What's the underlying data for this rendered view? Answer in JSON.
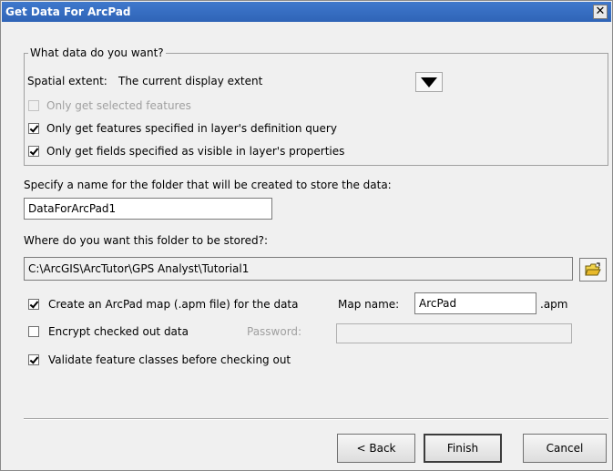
{
  "window": {
    "title": "Get Data For ArcPad",
    "close_label": "✕"
  },
  "data_group": {
    "legend": "What data do you want?",
    "spatial_extent_label": "Spatial extent:",
    "spatial_extent_value": "The current display extent",
    "options": [
      {
        "label": "Only get selected features",
        "checked": false,
        "enabled": false
      },
      {
        "label": "Only get features specified in layer's definition query",
        "checked": true,
        "enabled": true
      },
      {
        "label": "Only get fields specified as visible in layer's properties",
        "checked": true,
        "enabled": true
      }
    ]
  },
  "folder_name": {
    "label": "Specify a name for the folder that will be created to store the data:",
    "value": "DataForArcPad1"
  },
  "folder_location": {
    "label": "Where do you want this folder to be stored?:",
    "value": "C:\\ArcGIS\\ArcTutor\\GPS Analyst\\Tutorial1"
  },
  "map_options": {
    "create_map_label": "Create an ArcPad map (.apm file) for the data",
    "create_map_checked": true,
    "map_name_label": "Map name:",
    "map_name_value": "ArcPad",
    "map_ext": ".apm",
    "encrypt_label": "Encrypt checked out data",
    "encrypt_checked": false,
    "password_label": "Password:",
    "password_value": "",
    "validate_label": "Validate feature classes before checking out",
    "validate_checked": true
  },
  "buttons": {
    "back": "< Back",
    "finish": "Finish",
    "cancel": "Cancel"
  },
  "icons": {
    "dropdown": "chevron-down-icon",
    "browse": "folder-open-icon"
  },
  "colors": {
    "title_bar": "#3a70c4",
    "dialog_bg": "#f0f0f0",
    "disabled_text": "#a0a0a0"
  }
}
